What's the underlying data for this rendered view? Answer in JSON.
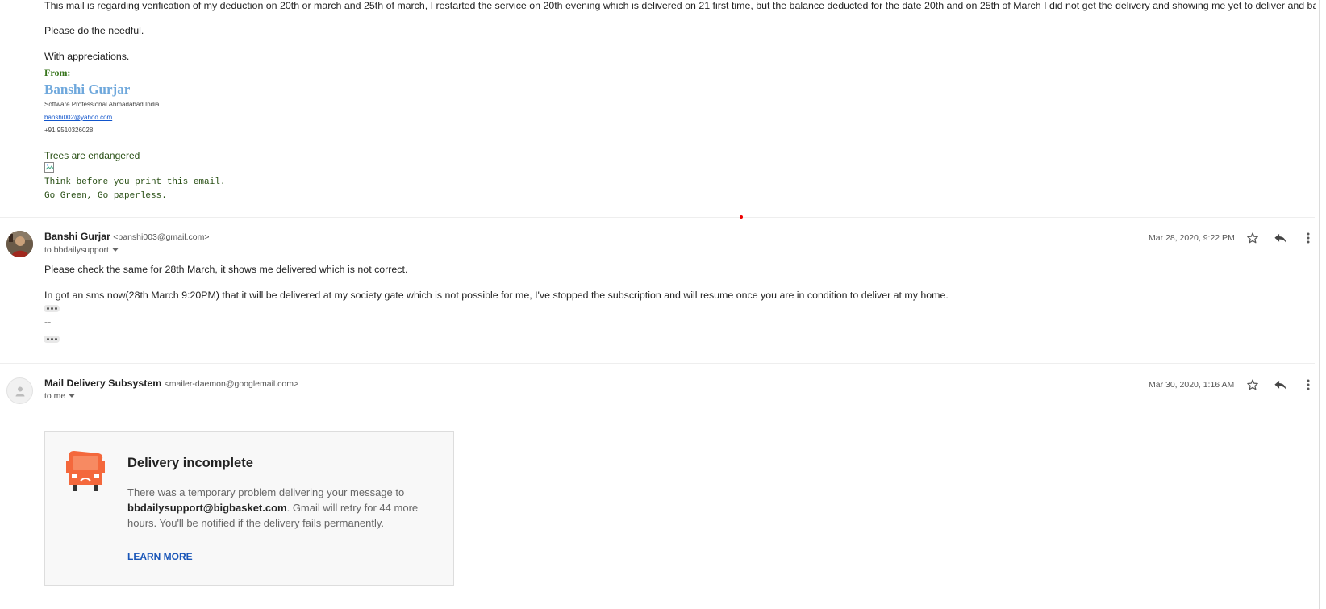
{
  "message1": {
    "body_line1": "This mail is regarding verification of my deduction on 20th or march and 25th of march, I restarted the service on 20th evening which is delivered on 21 first time, but the balance deducted for the date 20th and on 25th of March I did not get the delivery and showing me yet to deliver and balance deducted.",
    "body_line2": "Please do the needful.",
    "body_line3": "With appreciations.",
    "signature": {
      "from_label": "From:",
      "name": "Banshi Gurjar",
      "title": "Software Professional Ahmadabad India",
      "email": "banshi002@yahoo.com",
      "phone": "+91 9510326028",
      "trees": "Trees are endangered",
      "think": "Think before you print this email.",
      "green": "Go Green, Go paperless."
    }
  },
  "message2": {
    "sender_name": "Banshi Gurjar",
    "sender_email": "<banshi003@gmail.com>",
    "to_label": "to bbdailysupport",
    "date": "Mar 28, 2020, 9:22 PM",
    "body_line1": "Please check the same for 28th March, it shows me delivered which is not correct.",
    "body_line2": "In got an sms now(28th March 9:20PM) that it will be delivered at my society gate which is not possible for me, I've stopped the subscription and will resume once you are in condition to deliver at my home.",
    "dashes": "--"
  },
  "message3": {
    "sender_name": "Mail Delivery Subsystem",
    "sender_email": "<mailer-daemon@googlemail.com>",
    "to_label": "to me",
    "date": "Mar 30, 2020, 1:16 AM",
    "card": {
      "title": "Delivery incomplete",
      "text_before": "There was a temporary problem delivering your message to ",
      "recipient": "bbdailysupport@bigbasket.com",
      "text_after": ". Gmail will retry for 44 more hours. You'll be notified if the delivery fails permanently.",
      "learn_more": "LEARN MORE"
    }
  },
  "icons": [
    "star-icon",
    "reply-icon",
    "more-vert-icon",
    "chevron-down-icon",
    "broken-image-icon",
    "truck-icon",
    "avatar-placeholder-icon"
  ],
  "colors": {
    "signature_green": "#38761d",
    "signature_name": "#6fa8dc",
    "link_blue": "#1155cc",
    "learn_more": "#1a56b8",
    "truck": "#f4683c"
  }
}
